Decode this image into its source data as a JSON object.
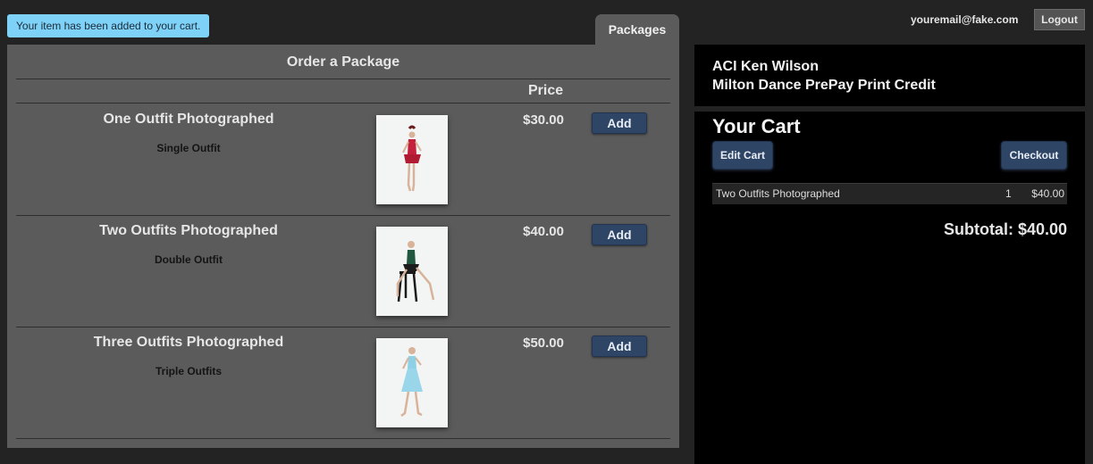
{
  "notice": "Your item has been added to your cart.",
  "tab": "Packages",
  "packages": {
    "title": "Order a Package",
    "price_header": "Price",
    "add_label": "Add",
    "items": [
      {
        "name": "One Outfit Photographed",
        "desc": "Single Outfit",
        "price": "$30.00",
        "dress_color": "#c4203b"
      },
      {
        "name": "Two Outfits Photographed",
        "desc": "Double Outfit",
        "price": "$40.00",
        "dress_color": "#22573f"
      },
      {
        "name": "Three Outfits Photographed",
        "desc": "Triple Outfits",
        "price": "$50.00",
        "dress_color": "#8ed0e6"
      }
    ]
  },
  "header": {
    "email": "youremail@fake.com",
    "logout": "Logout"
  },
  "account": {
    "name": "ACI Ken Wilson",
    "program": "Milton Dance PrePay Print Credit"
  },
  "cart": {
    "title": "Your Cart",
    "edit_label": "Edit Cart",
    "checkout_label": "Checkout",
    "items": [
      {
        "name": "Two Outfits Photographed",
        "qty": "1",
        "amount": "$40.00"
      }
    ],
    "subtotal": "Subtotal: $40.00"
  },
  "colors": {
    "accent_button": "#2f4566",
    "notice_bg": "#7fd2f7",
    "panel_bg": "#5b5b5b"
  }
}
